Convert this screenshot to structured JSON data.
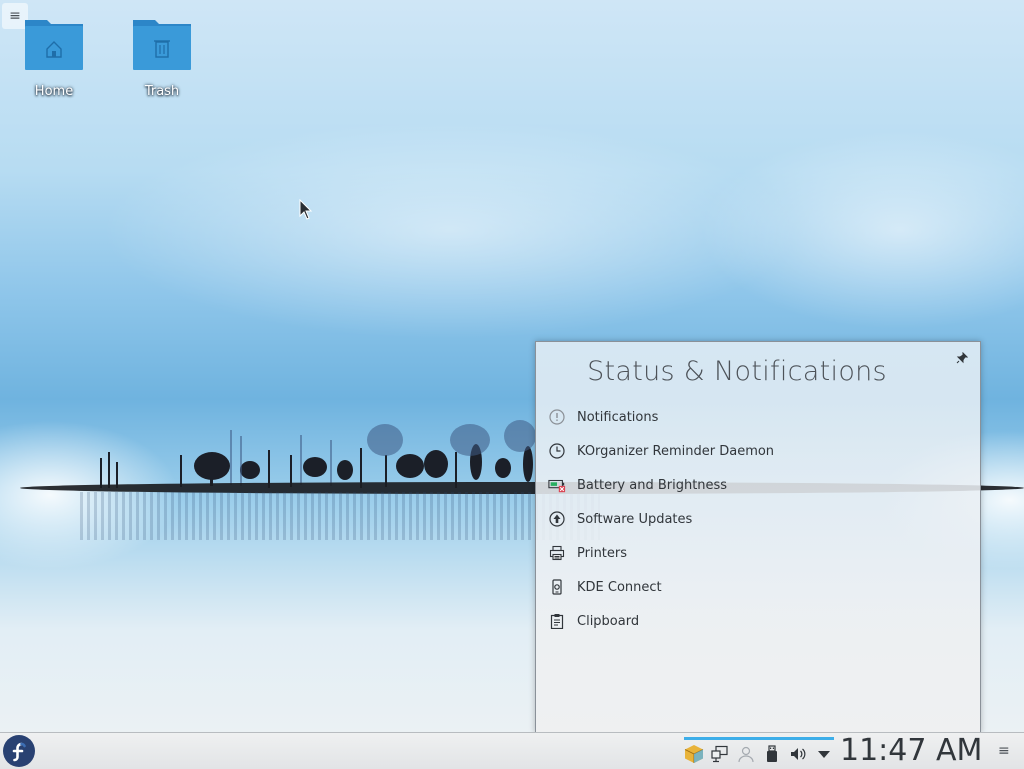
{
  "desktop": {
    "icons": [
      {
        "label": "Home",
        "glyph": "home-icon"
      },
      {
        "label": "Trash",
        "glyph": "trash-icon"
      }
    ],
    "toolbox_glyph": "≡"
  },
  "popup": {
    "title": "Status & Notifications",
    "pin_glyph": "📌",
    "items": [
      {
        "label": "Notifications",
        "icon": "notifications-icon"
      },
      {
        "label": "KOrganizer Reminder Daemon",
        "icon": "clock-icon"
      },
      {
        "label": "Battery and Brightness",
        "icon": "battery-icon"
      },
      {
        "label": "Software Updates",
        "icon": "software-updates-icon"
      },
      {
        "label": "Printers",
        "icon": "printer-icon"
      },
      {
        "label": "KDE Connect",
        "icon": "kde-connect-icon"
      },
      {
        "label": "Clipboard",
        "icon": "clipboard-icon"
      }
    ]
  },
  "panel": {
    "clock": "11:47 AM",
    "menu_glyph": "≡",
    "tray_icons": [
      "package-icon",
      "network-icon",
      "user-icon",
      "usb-icon",
      "volume-icon",
      "expand-arrow-icon"
    ]
  },
  "colors": {
    "accent": "#3daee9",
    "text": "#31363b",
    "launcher": "#294172",
    "folder": "#3a9ad9"
  }
}
